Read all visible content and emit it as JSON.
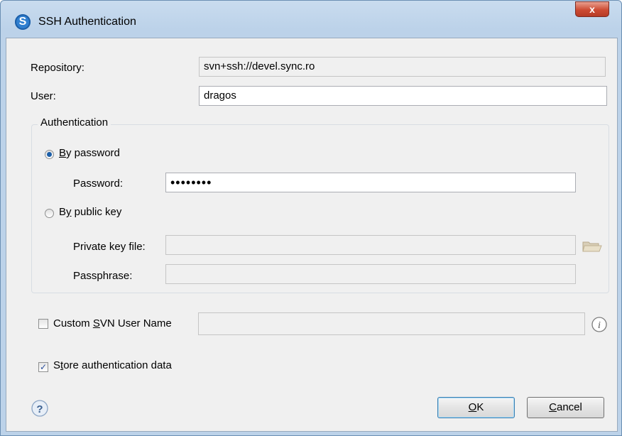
{
  "window": {
    "title": "SSH Authentication",
    "close_glyph": "x"
  },
  "repository": {
    "label": "Repository:",
    "value": "svn+ssh://devel.sync.ro"
  },
  "user": {
    "label": "User:",
    "value": "dragos"
  },
  "authentication": {
    "group_title": "Authentication",
    "by_password": {
      "label": "By password",
      "accel": "B",
      "rest": "y password",
      "selected": true
    },
    "password": {
      "label": "Password:",
      "value": "••••••••"
    },
    "by_public_key": {
      "label": "By public key",
      "pre": "B",
      "accel": "y",
      "rest": " public key",
      "selected": false
    },
    "private_key_file": {
      "label": "Private key file:",
      "value": ""
    },
    "passphrase": {
      "label": "Passphrase:",
      "value": ""
    }
  },
  "custom_svn_user": {
    "label": "Custom SVN User Name",
    "pre": "Custom ",
    "accel": "S",
    "rest": "VN User Name",
    "checked": false,
    "value": ""
  },
  "store_auth": {
    "label": "Store authentication data",
    "pre": "S",
    "accel": "t",
    "rest": "ore authentication data",
    "checked": true
  },
  "buttons": {
    "ok": {
      "label": "OK",
      "accel": "O",
      "rest": "K"
    },
    "cancel": {
      "label": "Cancel",
      "accel": "C",
      "rest": "ancel"
    }
  },
  "icons": {
    "app": "app-logo-icon",
    "folder": "folder-icon",
    "info": "info-icon",
    "help": "help-icon"
  }
}
